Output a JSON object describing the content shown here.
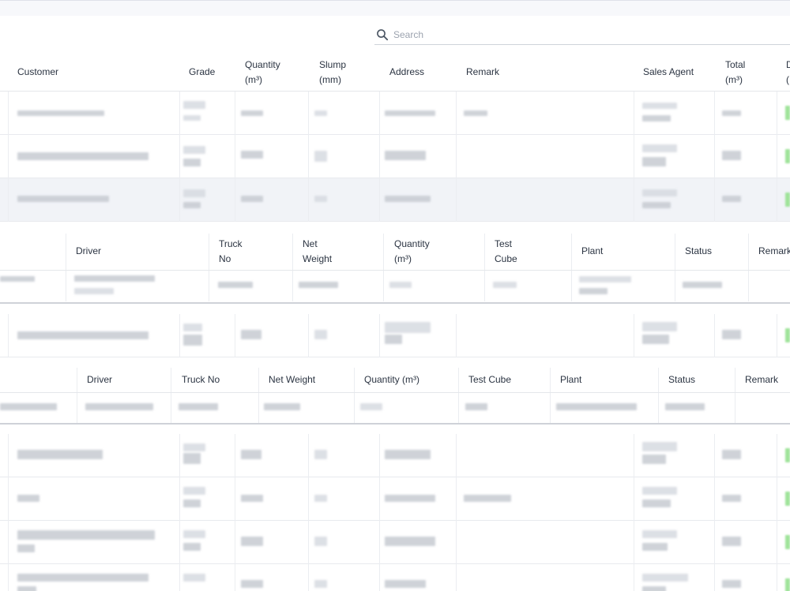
{
  "search": {
    "placeholder": "Search"
  },
  "orders_table": {
    "headers": {
      "customer": "Customer",
      "grade": "Grade",
      "quantity": "Quantity\n(m³)",
      "slump": "Slump\n(mm)",
      "address": "Address",
      "remark": "Remark",
      "sales_agent": "Sales Agent",
      "total": "Total\n(m³)",
      "d": "D\n("
    }
  },
  "delivery_table_1": {
    "headers": {
      "driver": "Driver",
      "truck_no": "Truck\nNo",
      "net_weight": "Net\nWeight",
      "quantity": "Quantity\n(m³)",
      "test_cube": "Test\nCube",
      "plant": "Plant",
      "status": "Status",
      "remark": "Remark"
    }
  },
  "delivery_table_2": {
    "headers": {
      "driver": "Driver",
      "truck_no": "Truck No",
      "net_weight": "Net Weight",
      "quantity": "Quantity (m³)",
      "test_cube": "Test Cube",
      "plant": "Plant",
      "status": "Status",
      "remark": "Remark"
    }
  }
}
